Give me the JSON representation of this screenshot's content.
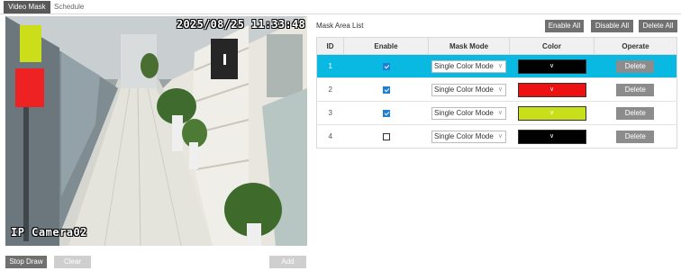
{
  "tabs": [
    {
      "label": "Video Mask"
    },
    {
      "label": "Schedule"
    }
  ],
  "video": {
    "timestamp": "2025/08/25 11:33:48",
    "camera_name": "IP Camera02",
    "masks": [
      {
        "color": "#ccdd1a"
      },
      {
        "color": "#ee2222"
      }
    ]
  },
  "buttons": {
    "stop_draw": "Stop Draw",
    "clear": "Clear",
    "add": "Add",
    "enable_all": "Enable All",
    "disable_all": "Disable All",
    "delete_all": "Delete All"
  },
  "mask_list": {
    "title": "Mask Area List",
    "columns": [
      "ID",
      "Enable",
      "Mask Mode",
      "Color",
      "Operate"
    ],
    "rows": [
      {
        "id": "1",
        "enabled": true,
        "mode": "Single Color Mode",
        "color": "#000000",
        "operate": "Delete",
        "selected": true
      },
      {
        "id": "2",
        "enabled": true,
        "mode": "Single Color Mode",
        "color": "#ee1111",
        "operate": "Delete",
        "selected": false
      },
      {
        "id": "3",
        "enabled": true,
        "mode": "Single Color Mode",
        "color": "#c8e01c",
        "operate": "Delete",
        "selected": false
      },
      {
        "id": "4",
        "enabled": false,
        "mode": "Single Color Mode",
        "color": "#000000",
        "operate": "Delete",
        "selected": false
      }
    ]
  },
  "icons": {
    "checkbox": "checkbox-icon",
    "dropdown": "chevron-down-icon"
  }
}
